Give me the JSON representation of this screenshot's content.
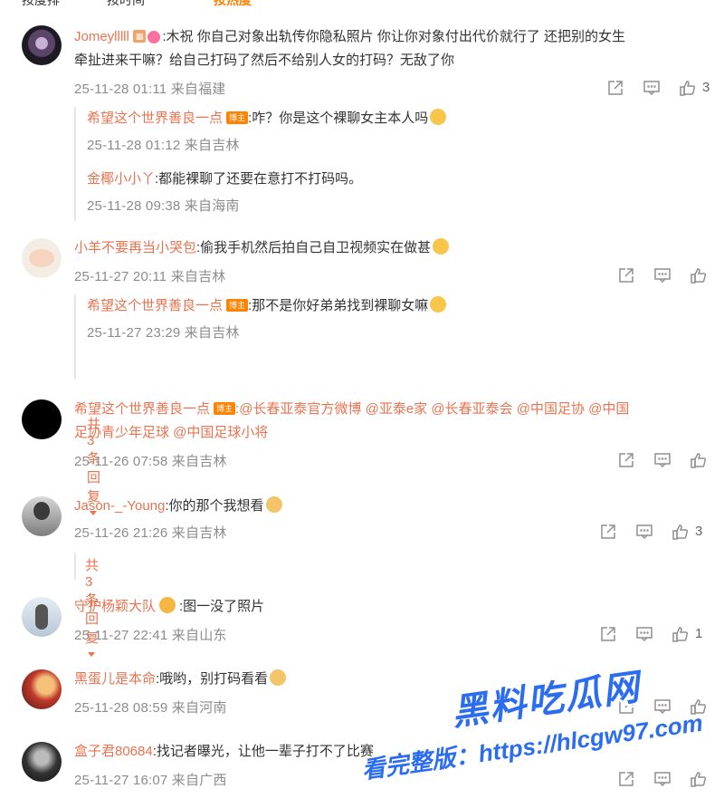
{
  "top_tabs": [
    "按度排",
    "按时间",
    "按热度"
  ],
  "comments": [
    {
      "user": "Jomeylllll",
      "text": ":木祝 你自己对象出轨传你隐私照片 你让你对象付出代价就行了 还把别的女生",
      "text2": "牵扯进来干嘛？给自己打码了然后不给别人女的打码？无敌了你",
      "time": "25-11-28 01:11 来自福建",
      "likes": "3",
      "replies": [
        {
          "user": "希望这个世界善良一点",
          "badge": "博主",
          "text": ":咋？你是这个裸聊女主本人吗",
          "time": "25-11-28 01:12 来自吉林"
        },
        {
          "user": "金椰小小丫",
          "text": ":都能裸聊了还要在意打不打码吗。",
          "time": "25-11-28 09:38 来自海南"
        }
      ]
    },
    {
      "user": "小羊不要再当小哭包",
      "text": ":偷我手机然后拍自己自卫视频实在做甚",
      "time": "25-11-27 20:11 来自吉林",
      "likes": "",
      "replies": [
        {
          "user": "希望这个世界善良一点",
          "badge": "博主",
          "text": ":那不是你好弟弟找到裸聊女嘛",
          "time": "25-11-27 23:29 来自吉林"
        }
      ],
      "more": "共3条回复"
    },
    {
      "user": "希望这个世界善良一点",
      "badge": "博主",
      "text": ":@长春亚泰官方微博 @亚泰e家 @长春亚泰会 @中国足协 @中国",
      "text2": "足协青少年足球 @中国足球小将",
      "time": "25-11-26 07:58 来自吉林",
      "likes": ""
    },
    {
      "user": "Jason-_-Young",
      "text": ":你的那个我想看",
      "time": "25-11-26 21:26 来自吉林",
      "likes": "3",
      "more": "共3条回复"
    },
    {
      "user": "守护杨颖大队",
      "text": ":图一没了照片",
      "time": "25-11-27 22:41 来自山东",
      "likes": "1"
    },
    {
      "user": "黑蛋儿是本命",
      "text": ":哦哟，别打码看看",
      "time": "25-11-28 08:59 来自河南",
      "likes": ""
    },
    {
      "user": "盒子君80684",
      "text": ":找记者曝光，让他一辈子打不了比赛",
      "time": "25-11-27 16:07 来自广西",
      "likes": ""
    }
  ],
  "watermark": {
    "title": "黑料吃瓜网",
    "url": "看完整版：https://hlcgw97.com"
  },
  "icons": [
    "share-icon",
    "comment-icon",
    "like-icon"
  ],
  "colors": {
    "username": "#eb7350",
    "meta": "#8c8c8c",
    "badge": "#ff8200",
    "watermark": "#2b6df0"
  }
}
